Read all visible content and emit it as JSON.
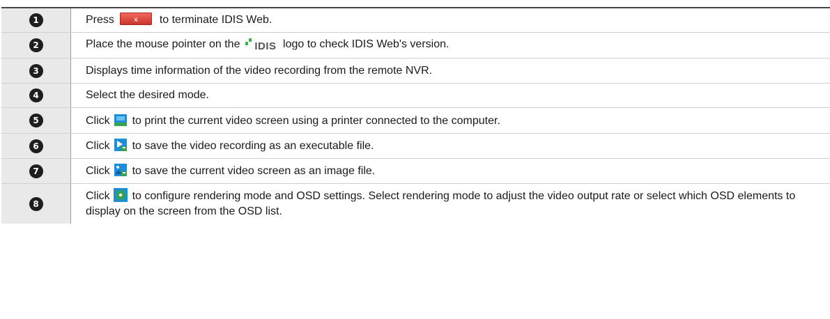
{
  "rows": [
    {
      "number": "1",
      "text_before": "Press",
      "icon": "close-button-icon",
      "text_after": "to terminate IDIS Web."
    },
    {
      "number": "2",
      "text_before": "Place the mouse pointer on the",
      "icon": "idis-logo-icon",
      "logo_text": "IDIS",
      "text_after": "logo to check IDIS Web's version."
    },
    {
      "number": "3",
      "text": "Displays time information of the video recording from the remote NVR."
    },
    {
      "number": "4",
      "text": "Select the desired mode."
    },
    {
      "number": "5",
      "text_before": "Click",
      "icon": "print-icon",
      "text_after": "to print the current video screen using a printer connected to the computer."
    },
    {
      "number": "6",
      "text_before": "Click",
      "icon": "save-clip-icon",
      "text_after": "to save the video recording as an executable file."
    },
    {
      "number": "7",
      "text_before": "Click",
      "icon": "save-image-icon",
      "text_after": "to save the current video screen as an image file."
    },
    {
      "number": "8",
      "text_before": "Click",
      "icon": "settings-gear-icon",
      "text_after": "to configure rendering mode and OSD settings. Select rendering mode to adjust the video output rate or select which OSD elements to display on the screen from the OSD list."
    }
  ],
  "colors": {
    "number_column_bg": "#e9e9e9",
    "badge_bg": "#1e1e1e",
    "close_button_red": "#e0453a",
    "idis_green": "#3ab54a",
    "icon_blue": "#1a8ed8",
    "icon_green": "#37a34a"
  }
}
